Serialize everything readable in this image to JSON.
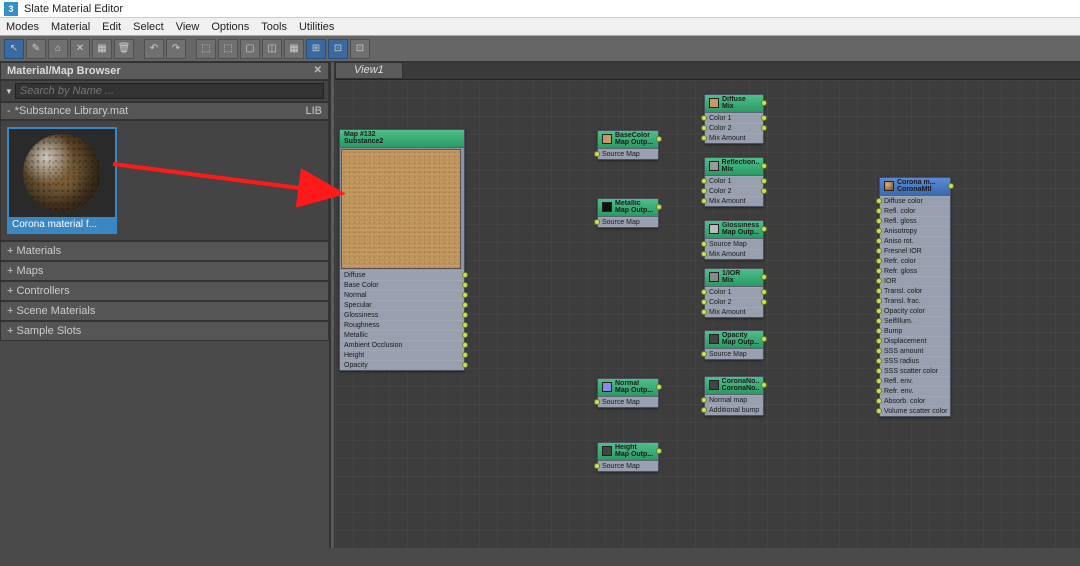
{
  "window": {
    "title": "Slate Material Editor",
    "app_icon": "3"
  },
  "menu": [
    "Modes",
    "Material",
    "Edit",
    "Select",
    "View",
    "Options",
    "Tools",
    "Utilities"
  ],
  "toolbar_icons": [
    "↖",
    "✎",
    "⌂",
    "✕",
    "▦",
    "🗑",
    "↶",
    "↷",
    "⬚",
    "⬚",
    "▢",
    "◫",
    "▦",
    "⊞",
    "⊡",
    "⊡"
  ],
  "browser": {
    "panel_title": "Material/Map Browser",
    "search_placeholder": "Search by Name ...",
    "library": {
      "name": "*Substance Library.mat",
      "tag": "LIB"
    },
    "thumb_label": "Corona material f...",
    "categories": [
      "+ Materials",
      "+ Maps",
      "+ Controllers",
      "+ Scene Materials",
      "+ Sample Slots"
    ]
  },
  "view": {
    "tab": "View1"
  },
  "nodes": {
    "substance": {
      "title": "Map #132",
      "subtitle": "Substance2",
      "outputs": [
        "Diffuse",
        "Base Color",
        "Normal",
        "Specular",
        "Glossiness",
        "Roughness",
        "Metallic",
        "Ambient Occlusion",
        "Height",
        "Opacity"
      ]
    },
    "basecolor": {
      "t1": "BaseColor",
      "t2": "Map Outp...",
      "r": "Source Map"
    },
    "metallic": {
      "t1": "Metallic",
      "t2": "Map Outp...",
      "r": "Source Map"
    },
    "normal": {
      "t1": "Normal",
      "t2": "Map Outp...",
      "r": "Source Map"
    },
    "height": {
      "t1": "Height",
      "t2": "Map Outp...",
      "r": "Source Map"
    },
    "diffuse": {
      "t1": "Diffuse",
      "t2": "Mix",
      "rows": [
        "Color 1",
        "Color 2",
        "Mix Amount"
      ]
    },
    "reflection": {
      "t1": "Reflection...",
      "t2": "Mix",
      "rows": [
        "Color 1",
        "Color 2",
        "Mix Amount"
      ]
    },
    "gloss": {
      "t1": "Glossiness",
      "t2": "Map Outp...",
      "rows": [
        "Source Map",
        "Mix Amount"
      ]
    },
    "ior": {
      "t1": "1/IOR",
      "t2": "Mix",
      "rows": [
        "Color 1",
        "Color 2",
        "Mix Amount"
      ]
    },
    "opacity": {
      "t1": "Opacity",
      "t2": "Map Outp...",
      "r": "Source Map"
    },
    "cnormal": {
      "t1": "CoronaNo...",
      "t2": "CoronaNo...",
      "rows": [
        "Normal map",
        "Additional bump"
      ]
    },
    "corona": {
      "t1": "Corona m...",
      "t2": "CoronaMtl",
      "rows": [
        "Diffuse color",
        "Refl. color",
        "Refl. gloss",
        "Anisotropy",
        "Aniso rot.",
        "Fresnel IOR",
        "Refr. color",
        "Refr. gloss",
        "IOR",
        "Transl. color",
        "Transl. frac.",
        "Opacity color",
        "SelfIllum.",
        "Bump",
        "Displacement",
        "SSS amount",
        "SSS radius",
        "SSS scatter color",
        "Refl. env.",
        "Refr. env.",
        "Absorb. color",
        "Volume scatter color"
      ]
    }
  }
}
